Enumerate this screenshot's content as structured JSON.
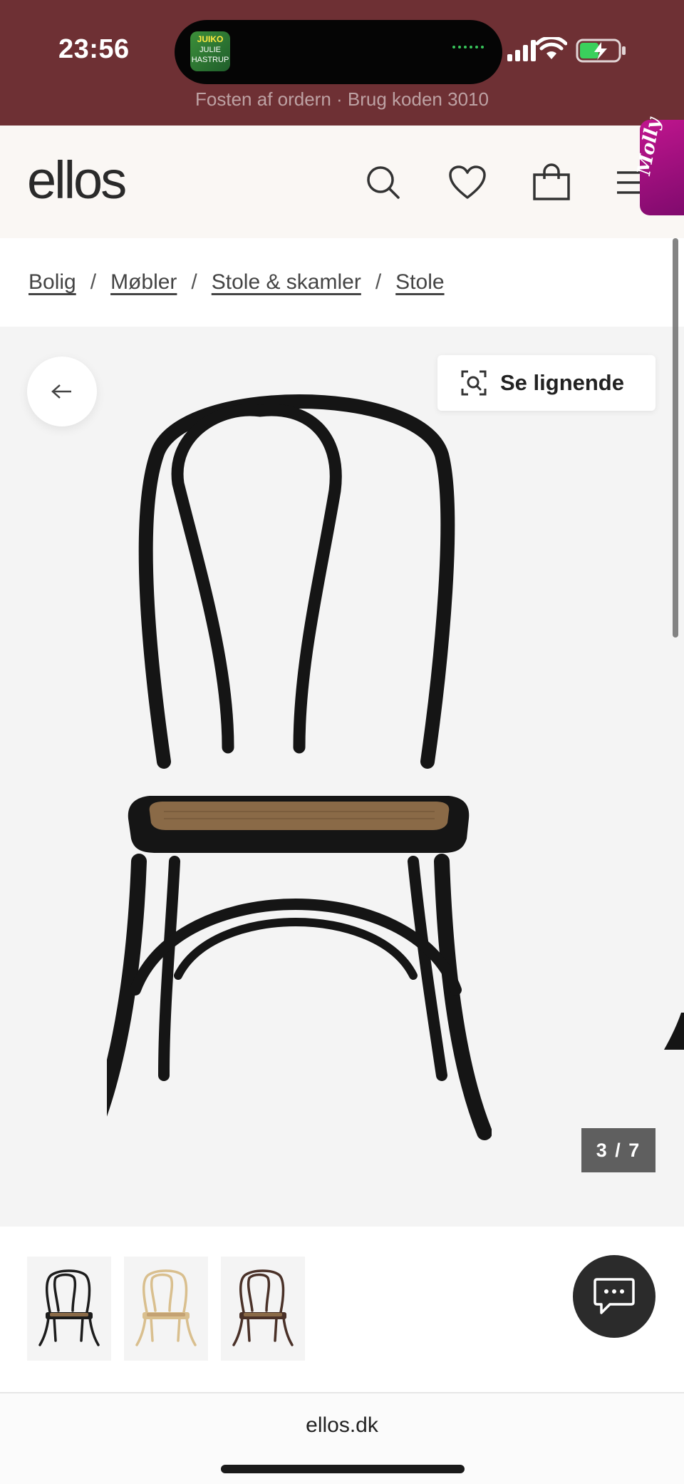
{
  "status_bar": {
    "time": "23:56",
    "now_playing_art": {
      "line1": "JUIKO",
      "line2": "JULIE",
      "line3": "HASTRUP"
    },
    "promo_text": "Fosten af ordern · Brug koden 3010",
    "background": "#6e3034"
  },
  "header": {
    "logo": "ellos",
    "icons": [
      "search-icon",
      "heart-icon",
      "bag-icon",
      "menu-icon"
    ],
    "assistant_tab": "Molly",
    "assistant_color": "#b0148a"
  },
  "breadcrumb": {
    "items": [
      "Bolig",
      "Møbler",
      "Stole & skamler",
      "Stole"
    ],
    "separator": "/"
  },
  "gallery": {
    "similar_button": "Se lignende",
    "counter": "3 / 7",
    "current_index": 3,
    "total": 7
  },
  "thumbnails": {
    "items": [
      {
        "variant": "black",
        "color": "#1c1c1c"
      },
      {
        "variant": "natural",
        "color": "#d9bf8e"
      },
      {
        "variant": "brown",
        "color": "#4a3128"
      }
    ]
  },
  "browser": {
    "url": "ellos.dk"
  }
}
